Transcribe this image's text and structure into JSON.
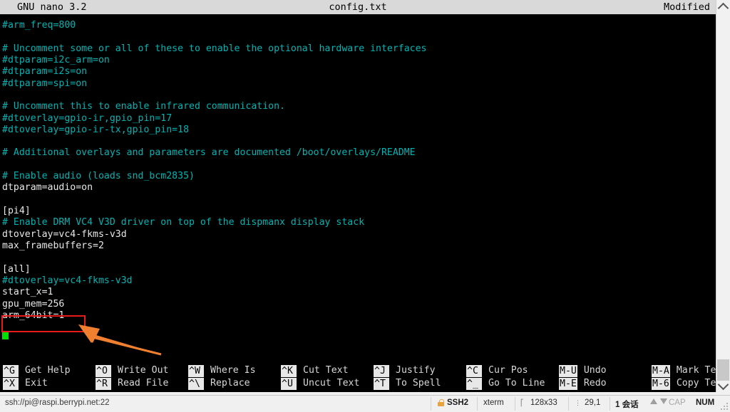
{
  "nano": {
    "title_version": "GNU nano 3.2",
    "filename": "config.txt",
    "modified": "Modified",
    "lines": [
      {
        "text": "#arm_freq=800",
        "style": "comment"
      },
      {
        "text": "",
        "style": "plain"
      },
      {
        "text": "# Uncomment some or all of these to enable the optional hardware interfaces",
        "style": "comment"
      },
      {
        "text": "#dtparam=i2c_arm=on",
        "style": "comment"
      },
      {
        "text": "#dtparam=i2s=on",
        "style": "comment"
      },
      {
        "text": "#dtparam=spi=on",
        "style": "comment"
      },
      {
        "text": "",
        "style": "plain"
      },
      {
        "text": "# Uncomment this to enable infrared communication.",
        "style": "comment"
      },
      {
        "text": "#dtoverlay=gpio-ir,gpio_pin=17",
        "style": "comment"
      },
      {
        "text": "#dtoverlay=gpio-ir-tx,gpio_pin=18",
        "style": "comment"
      },
      {
        "text": "",
        "style": "plain"
      },
      {
        "text": "# Additional overlays and parameters are documented /boot/overlays/README",
        "style": "comment"
      },
      {
        "text": "",
        "style": "plain"
      },
      {
        "text": "# Enable audio (loads snd_bcm2835)",
        "style": "comment"
      },
      {
        "text": "dtparam=audio=on",
        "style": "plain"
      },
      {
        "text": "",
        "style": "plain"
      },
      {
        "text": "[pi4]",
        "style": "plain"
      },
      {
        "text": "# Enable DRM VC4 V3D driver on top of the dispmanx display stack",
        "style": "comment"
      },
      {
        "text": "dtoverlay=vc4-fkms-v3d",
        "style": "plain"
      },
      {
        "text": "max_framebuffers=2",
        "style": "plain"
      },
      {
        "text": "",
        "style": "plain"
      },
      {
        "text": "[all]",
        "style": "plain"
      },
      {
        "text": "#dtoverlay=vc4-fkms-v3d",
        "style": "comment"
      },
      {
        "text": "start_x=1",
        "style": "plain"
      },
      {
        "text": "gpu_mem=256",
        "style": "plain"
      },
      {
        "text": "arm_64bit=1",
        "style": "plain"
      },
      {
        "text": "",
        "style": "plain"
      }
    ],
    "help": [
      {
        "key": "^G",
        "label": "Get Help",
        "key2": "^X",
        "label2": "Exit"
      },
      {
        "key": "^O",
        "label": "Write Out",
        "key2": "^R",
        "label2": "Read File"
      },
      {
        "key": "^W",
        "label": "Where Is",
        "key2": "^\\",
        "label2": "Replace"
      },
      {
        "key": "^K",
        "label": "Cut Text",
        "key2": "^U",
        "label2": "Uncut Text"
      },
      {
        "key": "^J",
        "label": "Justify",
        "key2": "^T",
        "label2": "To Spell"
      },
      {
        "key": "^C",
        "label": "Cur Pos",
        "key2": "^_",
        "label2": "Go To Line"
      },
      {
        "key": "M-U",
        "label": "Undo",
        "key2": "M-E",
        "label2": "Redo"
      },
      {
        "key": "M-A",
        "label": "Mark Text",
        "key2": "M-6",
        "label2": "Copy Text"
      }
    ]
  },
  "annotation": {
    "box_color": "#e81b1b",
    "arrow_color": "#f08030",
    "target_text": "arm_64bit=1"
  },
  "cursor": {
    "color": "#00e000"
  },
  "statusbar": {
    "url": "ssh://pi@raspi.berrypi.net:22",
    "protocol": "SSH2",
    "terminal_type": "xterm",
    "size": "128x33",
    "position": "29,1",
    "sessions": "1 会话",
    "cap": "CAP",
    "num": "NUM"
  }
}
